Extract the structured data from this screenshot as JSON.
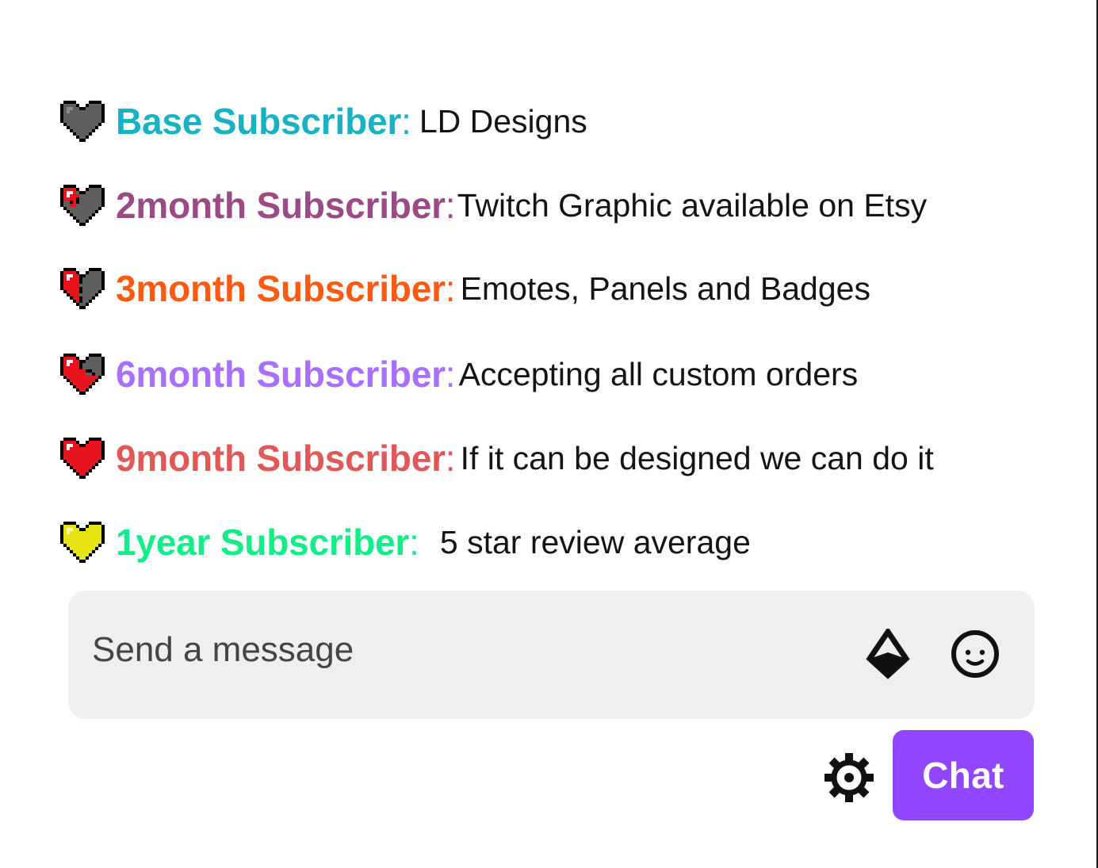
{
  "messages": [
    {
      "name": "Base Subscriber",
      "colon": ":",
      "text": " LD Designs",
      "color": "#17b3c4",
      "badge": "gray-pixel-heart-icon"
    },
    {
      "name": "2month Subscriber",
      "colon": ":",
      "text": "Twitch Graphic available on Etsy",
      "color": "#9b4a86",
      "badge": "quarter-red-pixel-heart-icon"
    },
    {
      "name": "3month Subscriber",
      "colon": ":",
      "text": "Emotes, Panels and Badges",
      "color": "#ff5a14",
      "badge": "half-red-pixel-heart-icon"
    },
    {
      "name": "6month Subscriber",
      "colon": ":",
      "text": "Accepting all custom orders",
      "color": "#a970ff",
      "badge": "three-quarter-red-pixel-heart-icon"
    },
    {
      "name": "9month Subscriber",
      "colon": ":",
      "text": "If it can be designed we can do it",
      "color": "#e05858",
      "badge": "full-red-pixel-heart-icon"
    },
    {
      "name": "1year Subscriber",
      "colon": ":",
      "text": "5 star review average",
      "color": "#11ee88",
      "badge": "yellow-pixel-heart-icon"
    }
  ],
  "input": {
    "placeholder": "Send a message",
    "bits_icon": "bits-icon",
    "emote_icon": "smiley-face-icon"
  },
  "footer": {
    "settings_icon": "gear-icon",
    "chat_button_label": "Chat",
    "chat_button_color": "#9147ff"
  }
}
